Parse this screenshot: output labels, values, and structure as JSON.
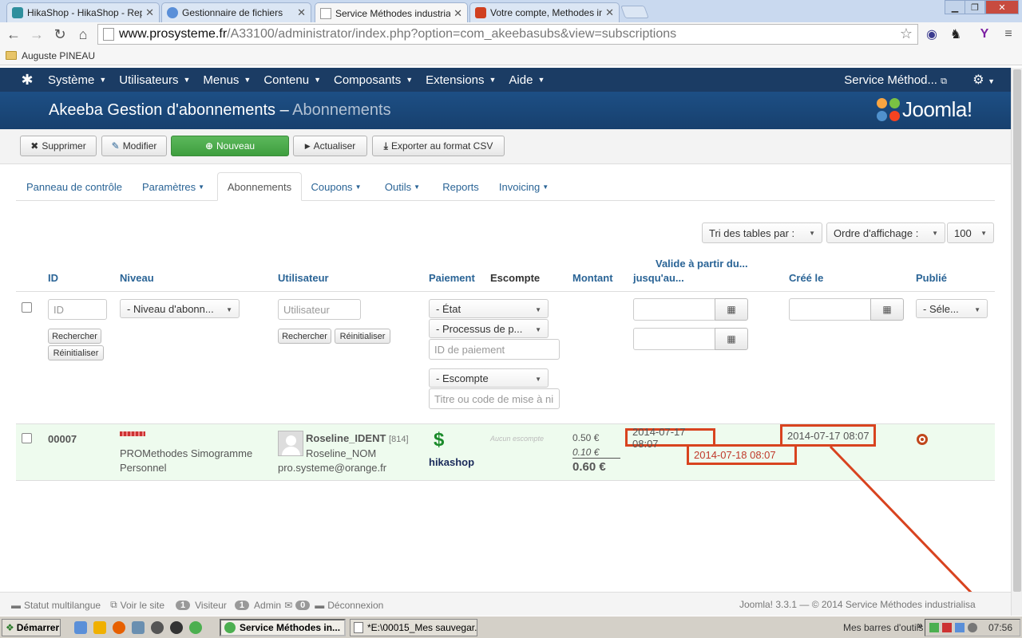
{
  "browser": {
    "tabs": [
      {
        "label": "HikaShop - HikaShop - Reply",
        "color": "#2f8f9d"
      },
      {
        "label": "Gestionnaire de fichiers",
        "color": "#5a8fd8"
      },
      {
        "label": "Service Méthodes industrialis",
        "color": "#ffffff"
      },
      {
        "label": "Votre compte, Methodes indu",
        "color": "#d04020"
      }
    ],
    "address_host": "www.prosysteme.fr",
    "address_path": "/A33100/administrator/index.php?option=com_akeebasubs&view=subscriptions",
    "bookmark": "Auguste PINEAU"
  },
  "topnav": {
    "items": [
      "Système",
      "Utilisateurs",
      "Menus",
      "Contenu",
      "Composants",
      "Extensions",
      "Aide"
    ],
    "site_link": "Service Méthod..."
  },
  "header": {
    "title": "Akeeba Gestion d'abonnements",
    "separator": " – ",
    "subtitle": "Abonnements",
    "brand": "Joomla!"
  },
  "toolbar": {
    "delete": "Supprimer",
    "edit": "Modifier",
    "new": "Nouveau",
    "refresh": "Actualiser",
    "export": "Exporter au format CSV"
  },
  "subtabs": {
    "control_panel": "Panneau de contrôle",
    "params": "Paramètres",
    "subs": "Abonnements",
    "coupons": "Coupons",
    "tools": "Outils",
    "reports": "Reports",
    "invoicing": "Invoicing"
  },
  "sorting": {
    "sort_by": "Tri des tables par :",
    "order": "Ordre d'affichage :",
    "limit": "100"
  },
  "columns": {
    "id": "ID",
    "level": "Niveau",
    "user": "Utilisateur",
    "payment": "Paiement",
    "discount": "Escompte",
    "amount": "Montant",
    "valid_from": "Valide à partir du...",
    "valid_to": "jusqu'au...",
    "created": "Créé le",
    "published": "Publié"
  },
  "filters": {
    "id_placeholder": "ID",
    "search": "Rechercher",
    "reset": "Réinitialiser",
    "level": "- Niveau d'abonn...",
    "user_placeholder": "Utilisateur",
    "state": "- État",
    "processor": "- Processus de p...",
    "payment_id_placeholder": "ID de paiement",
    "discount": "- Escompte",
    "coupon_placeholder": "Titre ou code de mise à ni",
    "published": "- Séle..."
  },
  "row": {
    "id": "00007",
    "level_line1": "PROMethodes Simogramme",
    "level_line2": "Personnel",
    "username": "Roseline_IDENT",
    "user_id": "[814]",
    "name": "Roseline_NOM",
    "email": "pro.systeme@orange.fr",
    "processor": "hikashop",
    "discount": "Aucun escompte",
    "net": "0.50 €",
    "tax": "0.10 €",
    "total": "0.60 €",
    "valid_from": "2014-07-17 08:07",
    "valid_to": "2014-07-18 08:07",
    "created": "2014-07-17 08:07"
  },
  "status": {
    "multilang": "Statut multilangue",
    "view_site": "Voir le site",
    "visitors_count": "1",
    "visitors": "Visiteur",
    "admin_count": "1",
    "admin": "Admin",
    "msg_count": "0",
    "logout": "Déconnexion",
    "version": "Joomla! 3.3.1 — © 2014 Service Méthodes industrialisa"
  },
  "taskbar": {
    "start": "Démarrer",
    "window1": "Service Méthodes in...",
    "window2": "*E:\\00015_Mes sauvegar...",
    "toolbars": "Mes barres d'outils",
    "clock": "07:56"
  },
  "colors": {
    "nav_bg": "#1b3c64",
    "header_bg": "#17406e",
    "link": "#2a6496",
    "highlight_box": "#d8431f",
    "row_bg": "#eefbee"
  }
}
